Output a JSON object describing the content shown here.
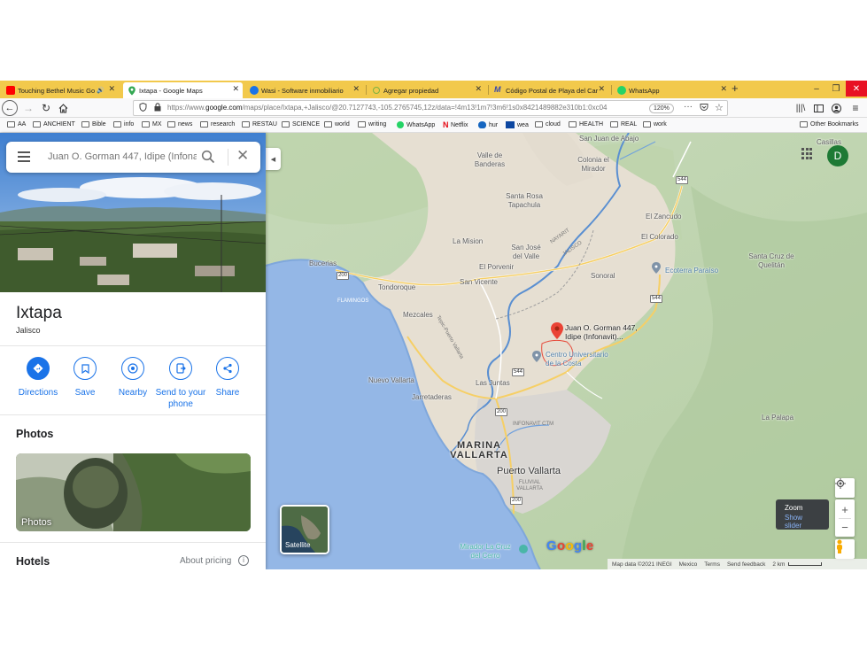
{
  "browser": {
    "tabs": [
      {
        "label": "Touching Bethel Music Go",
        "color": "#ff0000",
        "active": false,
        "audio": "🔊"
      },
      {
        "label": "Ixtapa - Google Maps",
        "color": "#34a853",
        "active": true
      },
      {
        "label": "Wasi - Software inmobiliario",
        "color": "#1a73e8",
        "active": false
      },
      {
        "label": "Agregar propiedad",
        "color": "#7cb342",
        "active": false
      },
      {
        "label": "Código Postal de Playa del Car",
        "color": "#3949ab",
        "active": false,
        "prefix": "M"
      },
      {
        "label": "WhatsApp",
        "color": "#25d366",
        "active": false
      }
    ],
    "new_tab": "+",
    "url_prefix": "https://www.",
    "url_domain": "google.com",
    "url_rest": "/maps/place/Ixtapa,+Jalisco/@20.7127743,-105.2765745,12z/data=!4m13!1m7!3m6!1s0x8421489882e310b1:0xc04",
    "zoom": "120%",
    "url_menu": "···",
    "bookmarks": [
      {
        "label": "AA",
        "type": "folder"
      },
      {
        "label": "ANCHIENT",
        "type": "folder"
      },
      {
        "label": "Bible",
        "type": "folder"
      },
      {
        "label": "info",
        "type": "folder"
      },
      {
        "label": "MX",
        "type": "folder"
      },
      {
        "label": "news",
        "type": "folder"
      },
      {
        "label": "research",
        "type": "folder"
      },
      {
        "label": "RESTAU",
        "type": "folder"
      },
      {
        "label": "SCIENCE",
        "type": "folder"
      },
      {
        "label": "world",
        "type": "folder"
      },
      {
        "label": "writing",
        "type": "folder"
      },
      {
        "label": "WhatsApp",
        "type": "site",
        "color": "#25d366"
      },
      {
        "label": "Netflix",
        "type": "site",
        "color": "#e50914"
      },
      {
        "label": "hur",
        "type": "site",
        "color": "#1565c0"
      },
      {
        "label": "wea",
        "type": "site",
        "color": "#0d47a1"
      },
      {
        "label": "cloud",
        "type": "folder"
      },
      {
        "label": "HEALTH",
        "type": "folder"
      },
      {
        "label": "REAL",
        "type": "folder"
      },
      {
        "label": "work",
        "type": "folder"
      }
    ],
    "other_bookmarks": "Other Bookmarks"
  },
  "maps": {
    "search_placeholder": "Juan O. Gorman 447, Idipe (Infonavit)",
    "place_name": "Ixtapa",
    "place_region": "Jalisco",
    "actions": [
      {
        "label": "Directions",
        "icon": "directions-icon"
      },
      {
        "label": "Save",
        "icon": "bookmark-icon"
      },
      {
        "label": "Nearby",
        "icon": "nearby-icon"
      },
      {
        "label": "Send to your phone",
        "icon": "send-to-phone-icon"
      },
      {
        "label": "Share",
        "icon": "share-icon"
      }
    ],
    "photos_heading": "Photos",
    "photo_card_label": "Photos",
    "hotels_heading": "Hotels",
    "about_pricing": "About pricing",
    "avatar_letter": "D",
    "satellite_label": "Satellite",
    "zoom_tooltip_title": "Zoom",
    "zoom_tooltip_link": "Show slider",
    "attribution": {
      "map_data": "Map data ©2021 INEGI",
      "country": "Mexico",
      "terms": "Terms",
      "feedback": "Send feedback",
      "scale": "2 km"
    },
    "pin_label": "Juan O. Gorman 447, Idipe (Infonavit)...",
    "map_labels": {
      "san_juan": "San Juan de Abajo",
      "casillas": "Casillas",
      "valle_banderas": "Valle de Banderas",
      "colonia_mirador": "Colonia el Mirador",
      "santa_rosa": "Santa Rosa Tapachula",
      "el_zancudo": "El Zancudo",
      "el_colorado": "El Colorado",
      "la_mision": "La Mision",
      "san_jose": "San José del Valle",
      "nayarit": "NAYARIT",
      "jalisco": "JALISCO",
      "santa_cruz": "Santa Cruz de Quelitán",
      "bucerias": "Bucerias",
      "el_porvenir": "El Porvenir",
      "ecoterra": "Ecoterra Paraíso",
      "sonoral": "Sonoral",
      "tondoroque": "Tondoroque",
      "san_vicente": "San Vicente",
      "flamingos": "FLAMINGOS",
      "mezcales": "Mezcales",
      "tepic_road": "Tepic-Puerto Vallarta",
      "centro_univ": "Centro Universitario de la Costa",
      "nuevo_vallarta": "Nuevo Vallarta",
      "las_juntas": "Las Juntas",
      "jarretaderas": "Jarretaderas",
      "infonavit_ctm": "INFONAVIT CTM",
      "la_palapa": "La Palapa",
      "marina_vallarta": "MARINA VALLARTA",
      "puerto_vallarta": "Puerto Vallarta",
      "fluvial_vallarta": "FLUVIAL VALLARTA",
      "mirador": "Mirador La Cruz del Cerro"
    },
    "shields": [
      "544",
      "200",
      "544",
      "544",
      "200",
      "200"
    ]
  }
}
